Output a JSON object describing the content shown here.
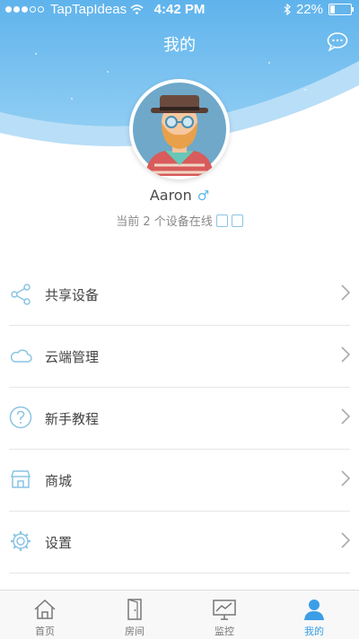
{
  "status_bar": {
    "carrier": "TapTapIdeas",
    "time": "4:42 PM",
    "battery": "22%"
  },
  "header": {
    "title": "我的"
  },
  "profile": {
    "name": "Aaron",
    "gender_symbol": "♂",
    "online_text": "当前 2 个设备在线"
  },
  "menu": [
    {
      "label": "共享设备",
      "icon": "share-icon"
    },
    {
      "label": "云端管理",
      "icon": "cloud-icon"
    },
    {
      "label": "新手教程",
      "icon": "help-icon"
    },
    {
      "label": "商城",
      "icon": "store-icon"
    },
    {
      "label": "设置",
      "icon": "gear-icon"
    }
  ],
  "tabs": [
    {
      "label": "首页",
      "icon": "home-icon"
    },
    {
      "label": "房间",
      "icon": "door-icon"
    },
    {
      "label": "监控",
      "icon": "monitor-icon"
    },
    {
      "label": "我的",
      "icon": "user-icon",
      "active": true
    }
  ],
  "colors": {
    "accent": "#3b9ee6",
    "header_bg": "#7cc0ee",
    "icon": "#8ac4e4"
  }
}
